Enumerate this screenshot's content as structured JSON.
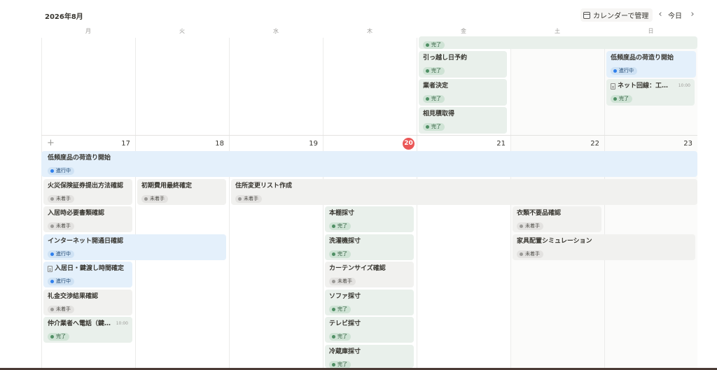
{
  "header": {
    "month_title": "2026年8月",
    "manage_label": "カレンダーで管理",
    "today_label": "今日",
    "prev_icon": "chevron-left-icon",
    "next_icon": "chevron-right-icon"
  },
  "weekdays": [
    "月",
    "火",
    "水",
    "木",
    "金",
    "土",
    "日"
  ],
  "week2_days": [
    "17",
    "18",
    "19",
    "20",
    "21",
    "22",
    "23"
  ],
  "today": "20",
  "statuses": {
    "done": "完了",
    "in_progress": "進行中",
    "not_started": "未着手"
  },
  "colors": {
    "today": "#eb5757",
    "done_bg": "#e9f0eb",
    "in_progress_bg": "#e4f0fb",
    "not_started_bg": "#f1f1ef"
  },
  "week1": [
    {
      "title": "",
      "status": "完了"
    },
    {
      "title": "引っ越し日予約",
      "status": "完了"
    },
    {
      "title": "低頻度品の荷造り開始",
      "status": "進行中"
    },
    {
      "title": "業者決定",
      "status": "完了"
    },
    {
      "title": "ネット回線：工事...",
      "time": "10:00",
      "status": "完了"
    },
    {
      "title": "相見積取得",
      "status": "完了"
    }
  ],
  "week2": [
    {
      "title": "低頻度品の荷造り開始",
      "status": "進行中"
    },
    {
      "title": "火災保険証券提出方法確認",
      "status": "未着手"
    },
    {
      "title": "初期費用最終確定",
      "status": "未着手"
    },
    {
      "title": "住所変更リスト作成",
      "status": "未着手"
    },
    {
      "title": "入居時必要書類確認",
      "status": "未着手"
    },
    {
      "title": "本棚採寸",
      "status": "完了"
    },
    {
      "title": "衣類不要品確認",
      "status": "未着手"
    },
    {
      "title": "インターネット開通日確認",
      "status": "進行中"
    },
    {
      "title": "洗濯機採寸",
      "status": "完了"
    },
    {
      "title": "家具配置シミュレーション",
      "status": "未着手"
    },
    {
      "title": "入居日・鍵渡し時間確定",
      "status": "進行中"
    },
    {
      "title": "カーテンサイズ確認",
      "status": "未着手"
    },
    {
      "title": "礼金交渉結果確認",
      "status": "未着手"
    },
    {
      "title": "ソファ採寸",
      "status": "完了"
    },
    {
      "title": "仲介業者へ電話（鍵...",
      "time": "10:00",
      "status": "完了"
    },
    {
      "title": "テレビ採寸",
      "status": "完了"
    },
    {
      "title": "冷蔵庫採寸",
      "status": "完了"
    }
  ]
}
